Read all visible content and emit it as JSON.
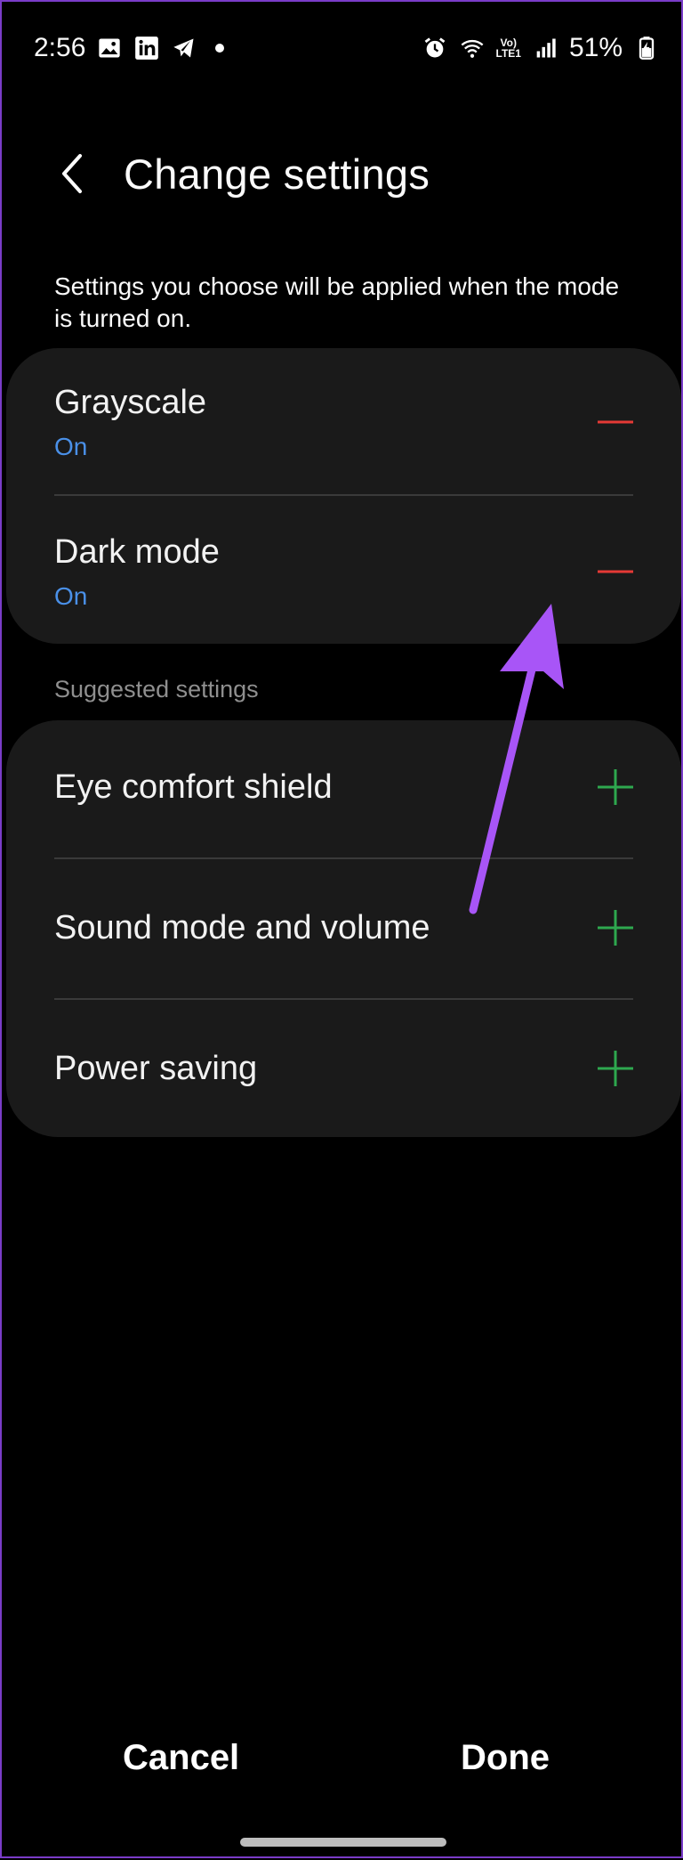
{
  "status_bar": {
    "time": "2:56",
    "battery": "51%",
    "lte_top": "Vo)",
    "lte_bottom": "LTE1"
  },
  "header": {
    "title": "Change settings"
  },
  "description": "Settings you choose will be applied when the mode is turned on.",
  "active_settings": [
    {
      "title": "Grayscale",
      "status": "On"
    },
    {
      "title": "Dark mode",
      "status": "On"
    }
  ],
  "suggested": {
    "header": "Suggested settings",
    "items": [
      {
        "title": "Eye comfort shield"
      },
      {
        "title": "Sound mode and volume"
      },
      {
        "title": "Power saving"
      }
    ]
  },
  "footer": {
    "cancel_label": "Cancel",
    "done_label": "Done"
  },
  "colors": {
    "remove_icon": "#e53935",
    "add_icon": "#2ea84f",
    "status_on": "#4a90e8",
    "annotation_arrow": "#a855f7"
  }
}
